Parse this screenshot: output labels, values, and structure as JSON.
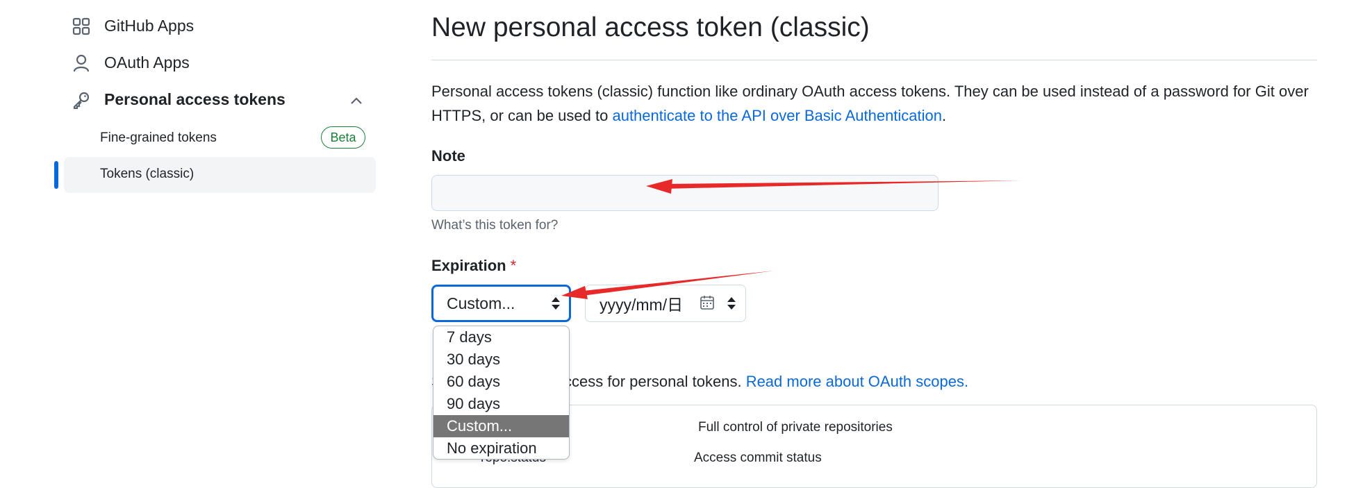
{
  "sidebar": {
    "github_apps": "GitHub Apps",
    "oauth_apps": "OAuth Apps",
    "personal_access_tokens": "Personal access tokens",
    "fine_grained": "Fine-grained tokens",
    "beta_badge": "Beta",
    "tokens_classic": "Tokens (classic)"
  },
  "main": {
    "title": "New personal access token (classic)",
    "description_1": "Personal access tokens (classic) function like ordinary OAuth access tokens. They can be used instead of a password for Git over HTTPS, or can be used to ",
    "description_link": "authenticate to the API over Basic Authentication",
    "description_2": ".",
    "note_label": "Note",
    "note_value": "",
    "note_hint": "What’s this token for?",
    "expiration_label": "Expiration",
    "required_mark": "*",
    "expiration_selected": "Custom...",
    "date_placeholder": "yyyy/mm/日",
    "expiration_options": [
      "7 days",
      "30 days",
      "60 days",
      "90 days",
      "Custom...",
      "No expiration"
    ],
    "scopes_partial_s": "S",
    "scopes_text": "ccess for personal tokens. ",
    "scopes_link": "Read more about OAuth scopes.",
    "scope_repo_desc": "Full control of private repositories",
    "scope_repo_status_label": "repo:status",
    "scope_repo_status_desc": "Access commit status"
  },
  "colors": {
    "accent": "#0969da",
    "annotation_arrow": "#e8292a",
    "beta_green": "#1a7f37",
    "required_red": "#cf222e"
  }
}
